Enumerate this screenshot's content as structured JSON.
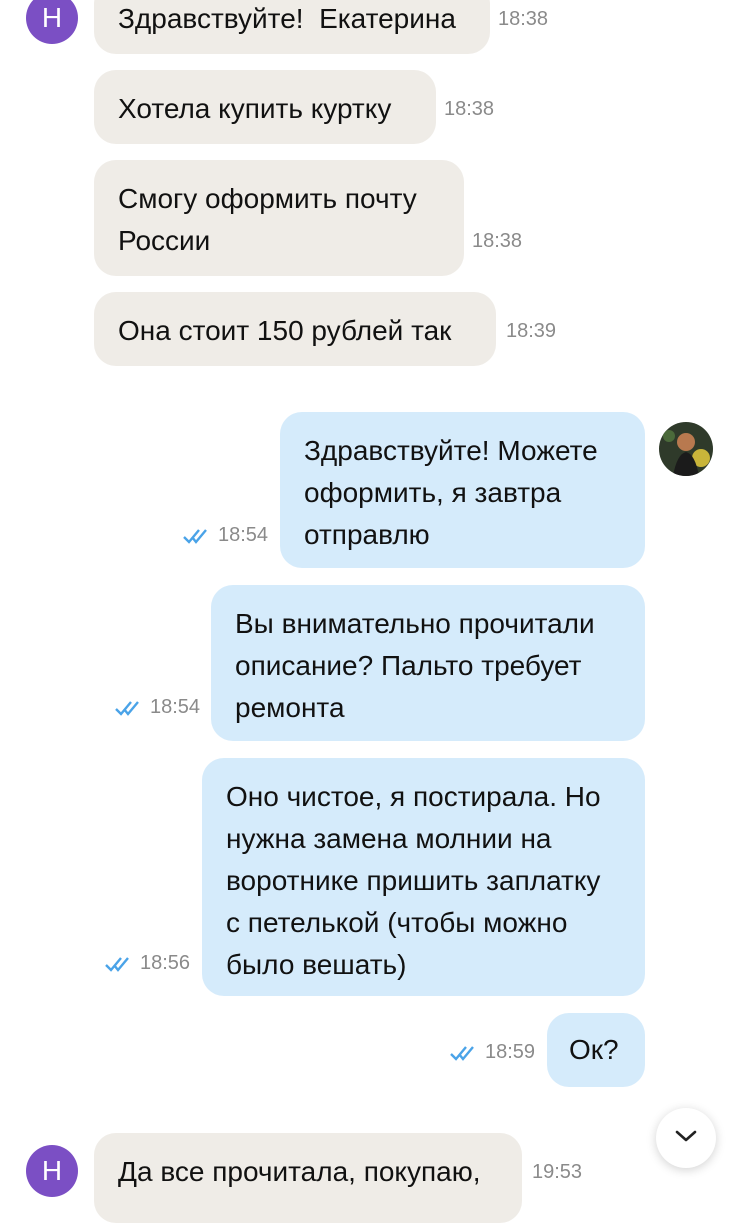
{
  "contact": {
    "initial": "Н"
  },
  "messages": [
    {
      "text": "Здравствуйте!  Екатерина",
      "time": "18:38"
    },
    {
      "text": "Хотела купить куртку",
      "time": "18:38"
    },
    {
      "text": "Смогу оформить почту России",
      "time": "18:38"
    },
    {
      "text": "Она стоит 150 рублей так",
      "time": "18:39"
    },
    {
      "text": "Здравствуйте! Можете оформить, я завтра отправлю",
      "time": "18:54",
      "read": true
    },
    {
      "text": "Вы внимательно прочитали описание? Пальто требует ремонта",
      "time": "18:54",
      "read": true
    },
    {
      "text": "Оно чистое, я постирала. Но нужна замена молнии на воротнике пришить заплатку с петелькой (чтобы можно было вешать)",
      "time": "18:56",
      "read": true
    },
    {
      "text": "Ок?",
      "time": "18:59",
      "read": true
    },
    {
      "text": "Да все прочитала, покупаю,",
      "time": "19:53"
    }
  ],
  "colors": {
    "incoming_bubble": "#efece7",
    "outgoing_bubble": "#d5ebfb",
    "avatar": "#7b4fc4",
    "read_check": "#4aa3e8",
    "time_text": "#8a8a8a"
  },
  "icons": {
    "read_status": "double-check-icon",
    "scroll_down": "chevron-down-icon",
    "seller_avatar": "user-photo-avatar"
  }
}
